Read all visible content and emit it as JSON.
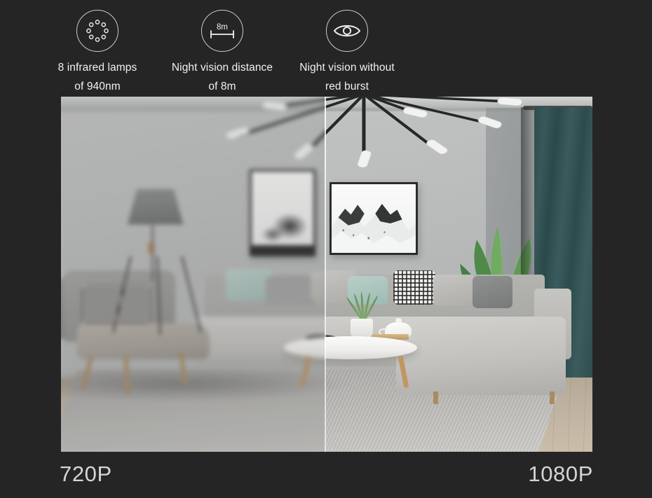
{
  "theme": {
    "background": "#252525",
    "text_color": "#f2f2f2",
    "icon_stroke": "#c9c9c9",
    "resolution_label_color": "#d4d5d5"
  },
  "features": [
    {
      "icon": "infrared-lamp-ring-icon",
      "line1": "8 infrared lamps",
      "line2": "of 940nm"
    },
    {
      "icon": "distance-ruler-icon",
      "icon_text": "8m",
      "line1": "Night vision distance",
      "line2": "of 8m"
    },
    {
      "icon": "eye-icon",
      "line1": "Night vision without",
      "line2": "red burst"
    }
  ],
  "comparison": {
    "left_label": "720P",
    "right_label": "1080P",
    "scene_description": "living room interior with sectional sofa, coffee table, floor lamp, framed artwork, chandelier and potted plant",
    "split_position_percent": 49.6
  }
}
